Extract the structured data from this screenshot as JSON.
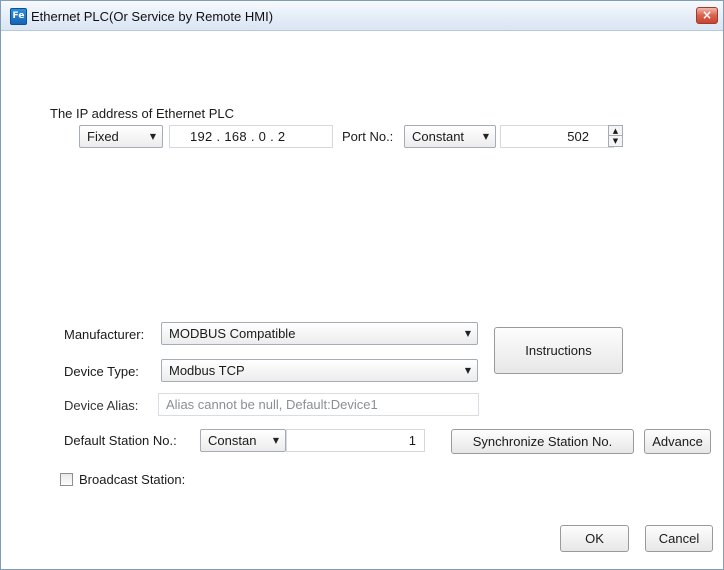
{
  "window": {
    "title": "Ethernet PLC(Or Service by Remote HMI)",
    "icon": "fe-app-icon",
    "close_glyph": "×"
  },
  "ip_section": {
    "heading": "The IP address of Ethernet PLC",
    "ip_mode": "Fixed",
    "ip_address": "192 . 168 .  0  .  2",
    "port_label": "Port No.:",
    "port_mode": "Constant",
    "port_value": "502"
  },
  "device": {
    "manufacturer_label": "Manufacturer:",
    "manufacturer_value": "MODBUS Compatible",
    "device_type_label": "Device Type:",
    "device_type_value": "Modbus TCP",
    "alias_label": "Device Alias:",
    "alias_placeholder": "Alias cannot be null, Default:Device1",
    "instructions_button": "Instructions",
    "station_label": "Default Station No.:",
    "station_mode": "Constan",
    "station_value": "1",
    "sync_button": "Synchronize Station No.",
    "advance_button": "Advance",
    "broadcast_label": "Broadcast Station:",
    "broadcast_checked": false
  },
  "footer": {
    "ok_button": "OK",
    "cancel_button": "Cancel"
  },
  "glyphs": {
    "dropdown": "▼",
    "spin_up": "▲",
    "spin_down": "▼"
  }
}
